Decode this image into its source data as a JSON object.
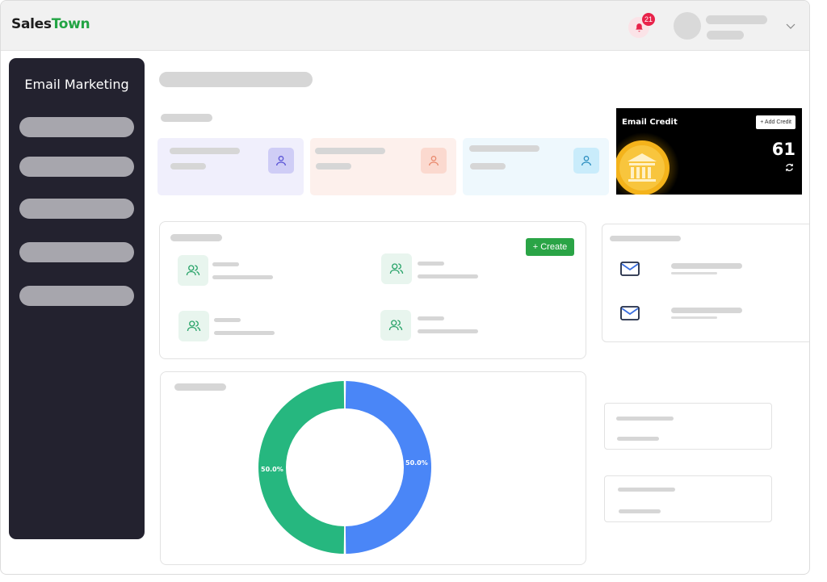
{
  "app": {
    "brand_part1": "Sales",
    "brand_part2": "Town",
    "brand_color": "#22a444",
    "notification_count": "21"
  },
  "sidebar": {
    "title": "Email Marketing",
    "item_count_placeholders": 5
  },
  "credit": {
    "label": "Email Credit",
    "add_label": "+ Add Credit",
    "value": "61"
  },
  "actions": {
    "create_label": "+ Create"
  },
  "icons": {
    "notification": "bell-icon",
    "user": "user-icon",
    "users": "users-icon",
    "mail": "mail-icon",
    "refresh": "refresh-icon",
    "dropdown": "chevron-down-icon",
    "bank": "bank-coin-icon"
  },
  "chart_data": {
    "type": "pie",
    "donut": true,
    "slices": [
      {
        "label": "50.0%",
        "value": 50.0,
        "color": "#4a86f7"
      },
      {
        "label": "50.0%",
        "value": 50.0,
        "color": "#26b77f"
      }
    ]
  }
}
